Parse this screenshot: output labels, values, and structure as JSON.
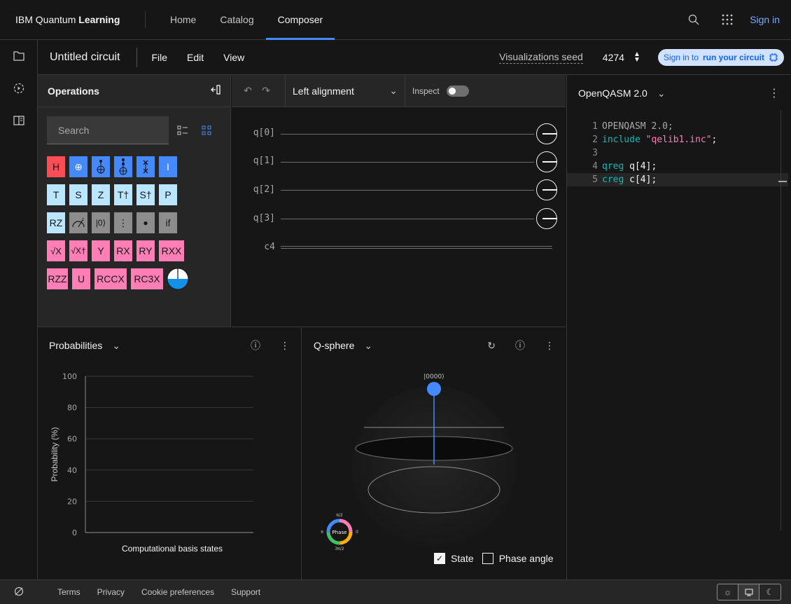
{
  "nav": {
    "brand_prefix": "IBM Quantum",
    "brand_bold": "Learning",
    "links": [
      "Home",
      "Catalog",
      "Composer"
    ],
    "active": "Composer",
    "signin": "Sign in"
  },
  "toolbar": {
    "title": "Untitled circuit",
    "menus": [
      "File",
      "Edit",
      "View"
    ],
    "vis_seed_label": "Visualizations seed",
    "seed_value": "4274",
    "run_prefix": "Sign in to",
    "run_bold": "run your circuit"
  },
  "operations": {
    "title": "Operations",
    "search_placeholder": "Search",
    "gates": [
      [
        "H",
        "⊕",
        "",
        "",
        "",
        "I"
      ],
      [
        "T",
        "S",
        "Z",
        "T†",
        "S†",
        "P"
      ],
      [
        "RZ",
        "",
        "|0⟩",
        "⋮",
        "●",
        "if"
      ],
      [
        "√X",
        "√X†",
        "Y",
        "RX",
        "RY",
        "RXX"
      ],
      [
        "RZZ",
        "U",
        "RCCX",
        "RC3X",
        ""
      ]
    ]
  },
  "canvas": {
    "alignment": "Left alignment",
    "inspect": "Inspect",
    "qubits": [
      "q[0]",
      "q[1]",
      "q[2]",
      "q[3]"
    ],
    "classical": "c4"
  },
  "code": {
    "language": "OpenQASM 2.0",
    "lines": [
      {
        "n": "1",
        "parts": [
          {
            "t": "OPENQASM 2.0;",
            "c": "dim"
          }
        ]
      },
      {
        "n": "2",
        "parts": [
          {
            "t": "include ",
            "c": "kw"
          },
          {
            "t": "\"qelib1.inc\"",
            "c": "str"
          },
          {
            "t": ";",
            "c": ""
          }
        ]
      },
      {
        "n": "3",
        "parts": []
      },
      {
        "n": "4",
        "parts": [
          {
            "t": "qreg ",
            "c": "kw"
          },
          {
            "t": "q[4];",
            "c": ""
          }
        ]
      },
      {
        "n": "5",
        "parts": [
          {
            "t": "creg ",
            "c": "kw"
          },
          {
            "t": "c[4];",
            "c": ""
          }
        ]
      }
    ]
  },
  "probabilities": {
    "title": "Probabilities",
    "chart_data": {
      "type": "bar",
      "title": "",
      "xlabel": "Computational basis states",
      "ylabel": "Probability (%)",
      "ylim": [
        0,
        100
      ],
      "yticks": [
        0,
        20,
        40,
        60,
        80,
        100
      ],
      "categories": [],
      "values": []
    }
  },
  "qsphere": {
    "title": "Q-sphere",
    "state_label": "|0000⟩",
    "phase": {
      "center": "Phase",
      "top": "π/2",
      "left": "π",
      "right": "0",
      "bottom": "3π/2"
    },
    "checkbox_state": "State",
    "checkbox_phase": "Phase angle",
    "state_checked": true,
    "phase_checked": false
  },
  "footer": {
    "links": [
      "Terms",
      "Privacy",
      "Cookie preferences",
      "Support"
    ]
  },
  "colors": {
    "accent": "#4589ff",
    "gate_red": "#fa4d56",
    "gate_blue": "#4589ff",
    "gate_light": "#bae6ff",
    "gate_gray": "#8d8d8d",
    "gate_pink": "#ff7eb6"
  }
}
